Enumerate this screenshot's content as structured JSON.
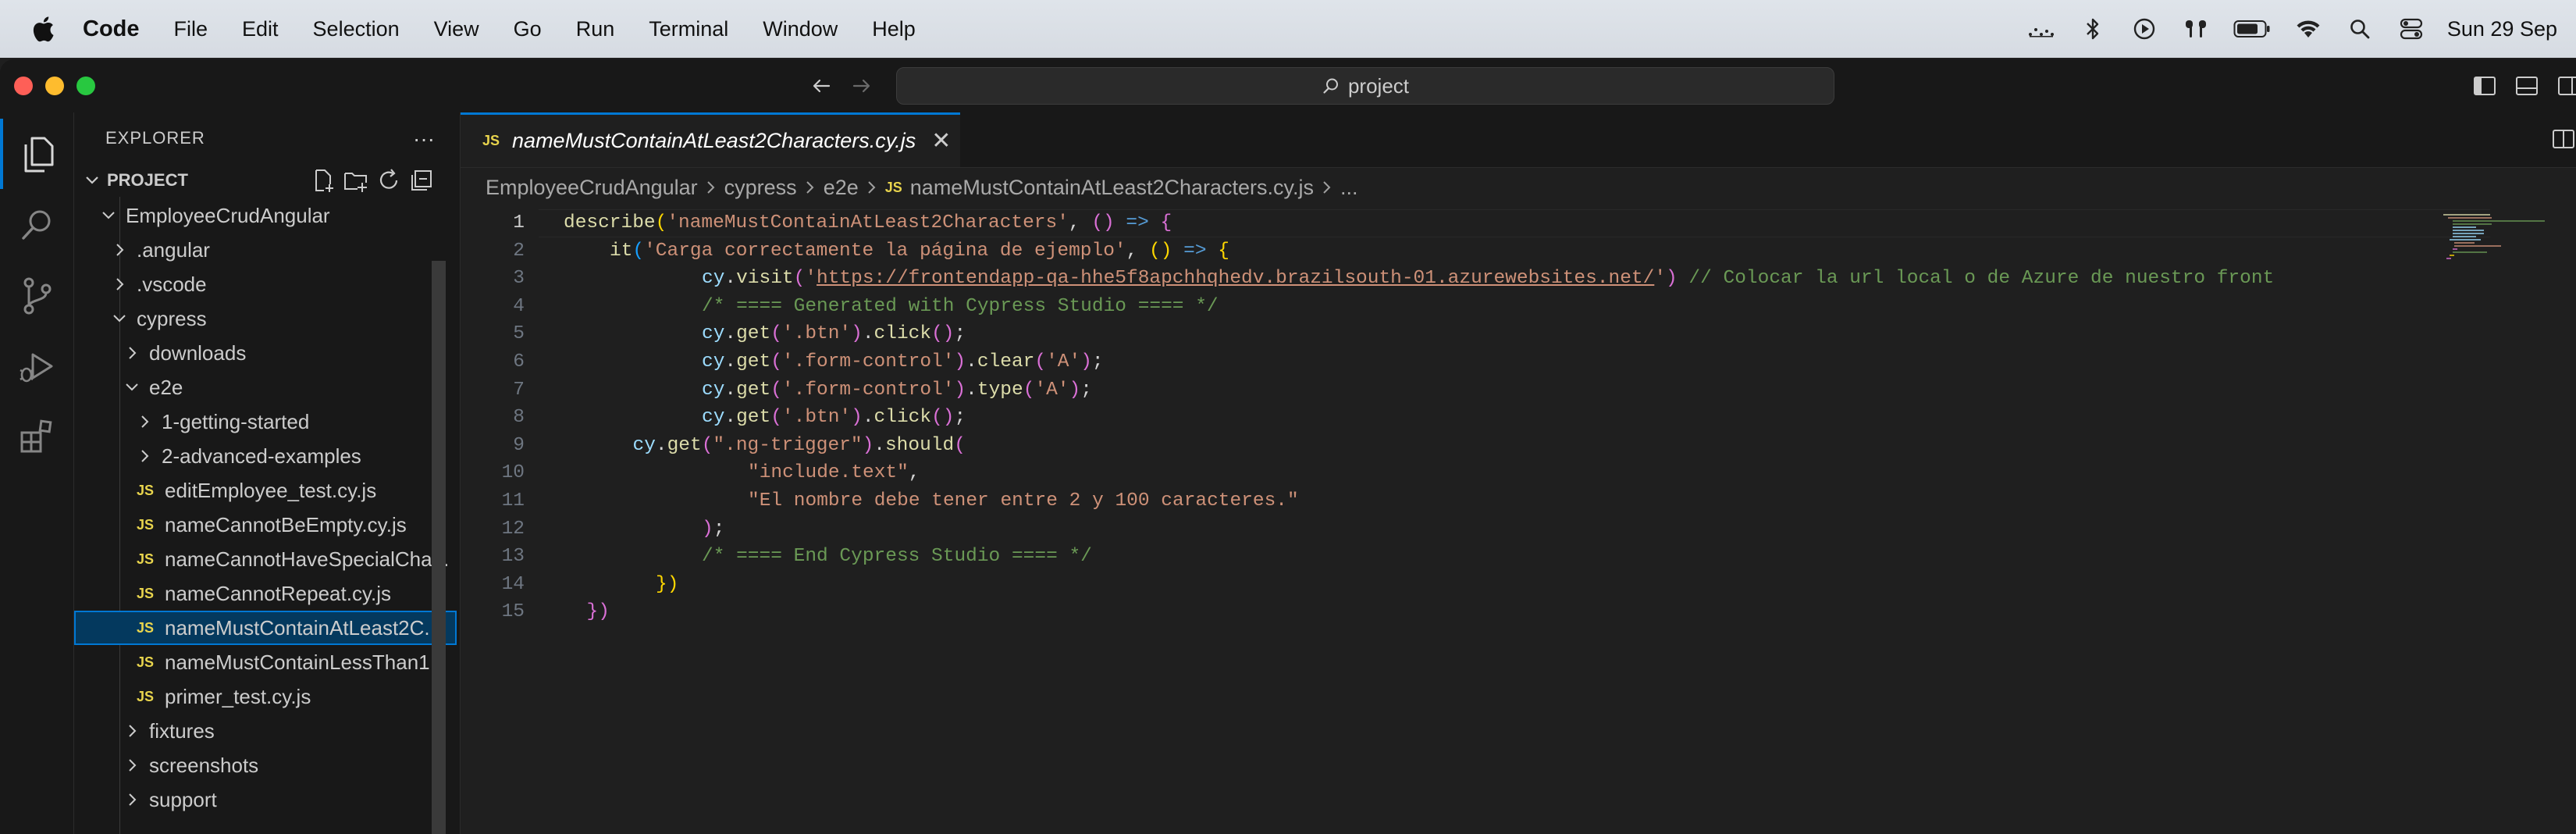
{
  "menubar": {
    "app_name": "Code",
    "items": [
      "File",
      "Edit",
      "Selection",
      "View",
      "Go",
      "Run",
      "Terminal",
      "Window",
      "Help"
    ],
    "clock": "Sun 29 Sep",
    "status_icons": [
      "voice-control-icon",
      "bluetooth-icon",
      "now-playing-icon",
      "airpods-icon",
      "battery-icon",
      "wifi-icon",
      "spotlight-search-icon",
      "control-center-icon"
    ]
  },
  "titlebar": {
    "search_text": "project"
  },
  "sidebar": {
    "title": "EXPLORER",
    "more": "···",
    "project_label": "PROJECT",
    "tree": [
      {
        "label": "EmployeeCrudAngular",
        "type": "folder",
        "open": true,
        "depth": 1
      },
      {
        "label": ".angular",
        "type": "folder",
        "open": false,
        "depth": 2
      },
      {
        "label": ".vscode",
        "type": "folder",
        "open": false,
        "depth": 2
      },
      {
        "label": "cypress",
        "type": "folder",
        "open": true,
        "depth": 2
      },
      {
        "label": "downloads",
        "type": "folder",
        "open": false,
        "depth": 3
      },
      {
        "label": "e2e",
        "type": "folder",
        "open": true,
        "depth": 3
      },
      {
        "label": "1-getting-started",
        "type": "folder",
        "open": false,
        "depth": 4
      },
      {
        "label": "2-advanced-examples",
        "type": "folder",
        "open": false,
        "depth": 4
      },
      {
        "label": "editEmployee_test.cy.js",
        "type": "js",
        "depth": 4
      },
      {
        "label": "nameCannotBeEmpty.cy.js",
        "type": "js",
        "depth": 4
      },
      {
        "label": "nameCannotHaveSpecialCha...",
        "type": "js",
        "depth": 4
      },
      {
        "label": "nameCannotRepeat.cy.js",
        "type": "js",
        "depth": 4
      },
      {
        "label": "nameMustContainAtLeast2C...",
        "type": "js",
        "depth": 4,
        "selected": true
      },
      {
        "label": "nameMustContainLessThan1...",
        "type": "js",
        "depth": 4
      },
      {
        "label": "primer_test.cy.js",
        "type": "js",
        "depth": 4
      },
      {
        "label": "fixtures",
        "type": "folder",
        "open": false,
        "depth": 3
      },
      {
        "label": "screenshots",
        "type": "folder",
        "open": false,
        "depth": 3
      },
      {
        "label": "support",
        "type": "folder",
        "open": false,
        "depth": 3
      }
    ]
  },
  "editor": {
    "tab": {
      "icon_text": "JS",
      "label": "nameMustContainAtLeast2Characters.cy.js",
      "close": "✕"
    },
    "breadcrumb": [
      "EmployeeCrudAngular",
      "cypress",
      "e2e",
      "nameMustContainAtLeast2Characters.cy.js",
      "..."
    ],
    "breadcrumb_file_icon": "JS",
    "current_line": 1,
    "lines": [
      {
        "n": "1",
        "indent": 0,
        "tokens": [
          [
            "fn",
            "describe"
          ],
          [
            "br1",
            "("
          ],
          [
            "str",
            "'nameMustContainAtLeast2Characters'"
          ],
          [
            "plain",
            ", "
          ],
          [
            "br2",
            "()"
          ],
          [
            "kw",
            " => "
          ],
          [
            "br2",
            "{"
          ]
        ]
      },
      {
        "n": "2",
        "indent": 1,
        "tokens": [
          [
            "fn",
            "it"
          ],
          [
            "br3",
            "("
          ],
          [
            "str",
            "'Carga correctamente la página de ejemplo'"
          ],
          [
            "plain",
            ", "
          ],
          [
            "br1",
            "()"
          ],
          [
            "kw",
            " => "
          ],
          [
            "br1",
            "{"
          ]
        ]
      },
      {
        "n": "3",
        "indent": 3,
        "tokens": [
          [
            "var",
            "cy"
          ],
          [
            "plain",
            "."
          ],
          [
            "fn",
            "visit"
          ],
          [
            "br2",
            "("
          ],
          [
            "str",
            "'"
          ],
          [
            "url",
            "https://frontendapp-qa-hhe5f8apchhqhedv.brazilsouth-01.azurewebsites.net/"
          ],
          [
            "str",
            "'"
          ],
          [
            "br2",
            ")"
          ],
          [
            "com",
            " // Colocar la url local o de Azure de nuestro front"
          ]
        ]
      },
      {
        "n": "4",
        "indent": 3,
        "tokens": [
          [
            "com",
            "/* ==== Generated with Cypress Studio ==== */"
          ]
        ]
      },
      {
        "n": "5",
        "indent": 3,
        "tokens": [
          [
            "var",
            "cy"
          ],
          [
            "plain",
            "."
          ],
          [
            "fn",
            "get"
          ],
          [
            "br2",
            "("
          ],
          [
            "str",
            "'.btn'"
          ],
          [
            "br2",
            ")"
          ],
          [
            "plain",
            "."
          ],
          [
            "fn",
            "click"
          ],
          [
            "br2",
            "()"
          ],
          [
            "plain",
            ";"
          ]
        ]
      },
      {
        "n": "6",
        "indent": 3,
        "tokens": [
          [
            "var",
            "cy"
          ],
          [
            "plain",
            "."
          ],
          [
            "fn",
            "get"
          ],
          [
            "br2",
            "("
          ],
          [
            "str",
            "'.form-control'"
          ],
          [
            "br2",
            ")"
          ],
          [
            "plain",
            "."
          ],
          [
            "fn",
            "clear"
          ],
          [
            "br2",
            "("
          ],
          [
            "str",
            "'A'"
          ],
          [
            "br2",
            ")"
          ],
          [
            "plain",
            ";"
          ]
        ]
      },
      {
        "n": "7",
        "indent": 3,
        "tokens": [
          [
            "var",
            "cy"
          ],
          [
            "plain",
            "."
          ],
          [
            "fn",
            "get"
          ],
          [
            "br2",
            "("
          ],
          [
            "str",
            "'.form-control'"
          ],
          [
            "br2",
            ")"
          ],
          [
            "plain",
            "."
          ],
          [
            "fn",
            "type"
          ],
          [
            "br2",
            "("
          ],
          [
            "str",
            "'A'"
          ],
          [
            "br2",
            ")"
          ],
          [
            "plain",
            ";"
          ]
        ]
      },
      {
        "n": "8",
        "indent": 3,
        "tokens": [
          [
            "var",
            "cy"
          ],
          [
            "plain",
            "."
          ],
          [
            "fn",
            "get"
          ],
          [
            "br2",
            "("
          ],
          [
            "str",
            "'.btn'"
          ],
          [
            "br2",
            ")"
          ],
          [
            "plain",
            "."
          ],
          [
            "fn",
            "click"
          ],
          [
            "br2",
            "()"
          ],
          [
            "plain",
            ";"
          ]
        ]
      },
      {
        "n": "9",
        "indent": 1.5,
        "tokens": [
          [
            "var",
            "cy"
          ],
          [
            "plain",
            "."
          ],
          [
            "fn",
            "get"
          ],
          [
            "br2",
            "("
          ],
          [
            "str",
            "\".ng-trigger\""
          ],
          [
            "br2",
            ")"
          ],
          [
            "plain",
            "."
          ],
          [
            "fn",
            "should"
          ],
          [
            "br2",
            "("
          ]
        ]
      },
      {
        "n": "10",
        "indent": 4,
        "tokens": [
          [
            "str",
            "\"include.text\""
          ],
          [
            "plain",
            ","
          ]
        ]
      },
      {
        "n": "11",
        "indent": 4,
        "tokens": [
          [
            "str",
            "\"El nombre debe tener entre 2 y 100 caracteres.\""
          ]
        ]
      },
      {
        "n": "12",
        "indent": 3,
        "tokens": [
          [
            "br2",
            ")"
          ],
          [
            "plain",
            ";"
          ]
        ]
      },
      {
        "n": "13",
        "indent": 3,
        "tokens": [
          [
            "com",
            "/* ==== End Cypress Studio ==== */"
          ]
        ]
      },
      {
        "n": "14",
        "indent": 2,
        "tokens": [
          [
            "br1",
            "})"
          ]
        ]
      },
      {
        "n": "15",
        "indent": 0.5,
        "tokens": [
          [
            "br2",
            "})"
          ]
        ]
      }
    ]
  }
}
